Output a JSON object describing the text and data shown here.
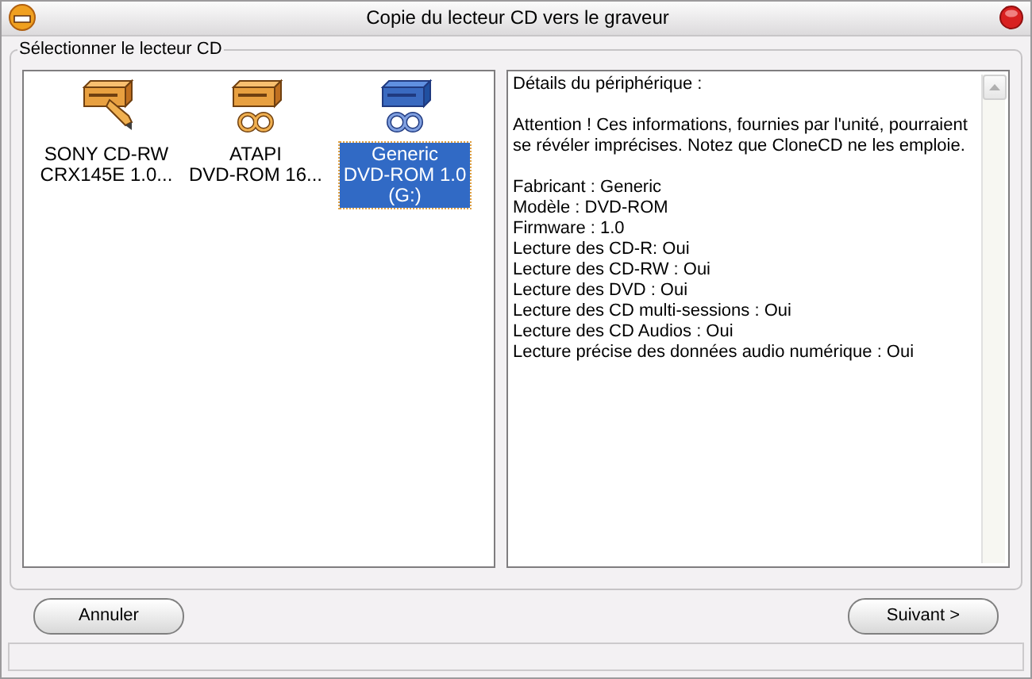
{
  "window": {
    "title": "Copie du lecteur CD vers le graveur"
  },
  "group": {
    "legend": "Sélectionner le lecteur CD"
  },
  "drives": [
    {
      "kind": "burner",
      "lines": [
        "SONY CD-RW",
        "CRX145E 1.0..."
      ],
      "selected": false
    },
    {
      "kind": "reader",
      "lines": [
        "ATAPI",
        "DVD-ROM 16..."
      ],
      "selected": false
    },
    {
      "kind": "reader",
      "lines": [
        "Generic",
        "DVD-ROM 1.0",
        "(G:)"
      ],
      "selected": true
    }
  ],
  "details": {
    "heading": "Détails du périphérique :",
    "warning": "Attention ! Ces informations, fournies par l'unité, pourraient se révéler imprécises. Notez que CloneCD ne les emploie.",
    "properties": [
      "Fabricant : Generic",
      "Modèle : DVD-ROM",
      "Firmware : 1.0",
      "Lecture des CD-R: Oui",
      "Lecture des CD-RW : Oui",
      "Lecture des DVD : Oui",
      "Lecture des CD multi-sessions : Oui",
      "Lecture des CD Audios : Oui",
      "Lecture précise des données audio numérique : Oui"
    ]
  },
  "buttons": [
    {
      "label": "Annuler"
    },
    {
      "label": "Suivant >"
    }
  ]
}
